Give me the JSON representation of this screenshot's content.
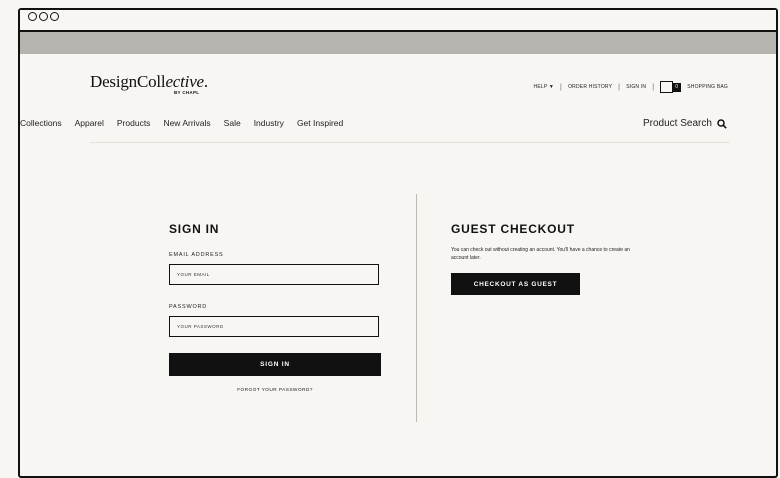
{
  "brand": {
    "name_regular": "DesignColl",
    "name_italic": "ective",
    "name_dot": ".",
    "sub": "BY CHAPL"
  },
  "utility_nav": {
    "help": "HELP",
    "order_history": "ORDER HISTORY",
    "sign_in": "SIGN IN",
    "bag_count": "0",
    "shopping_bag": "SHOPPING BAG",
    "separator": "|"
  },
  "nav": {
    "items": [
      "Collections",
      "Apparel",
      "Products",
      "New Arrivals",
      "Sale",
      "Industry",
      "Get Inspired"
    ]
  },
  "search": {
    "label": "Product Search"
  },
  "signin": {
    "title": "SIGN IN",
    "email_label": "EMAIL ADDRESS",
    "email_placeholder": "YOUR EMAIL",
    "password_label": "PASSWORD",
    "password_placeholder": "YOUR PASSWORD",
    "button": "SIGN IN",
    "forgot": "FORGOT YOUR PASSWORD?"
  },
  "guest": {
    "title": "GUEST CHECKOUT",
    "description": "You can check out without creating an account. You'll have a chance to create an account later.",
    "button": "CHECKOUT AS GUEST"
  }
}
